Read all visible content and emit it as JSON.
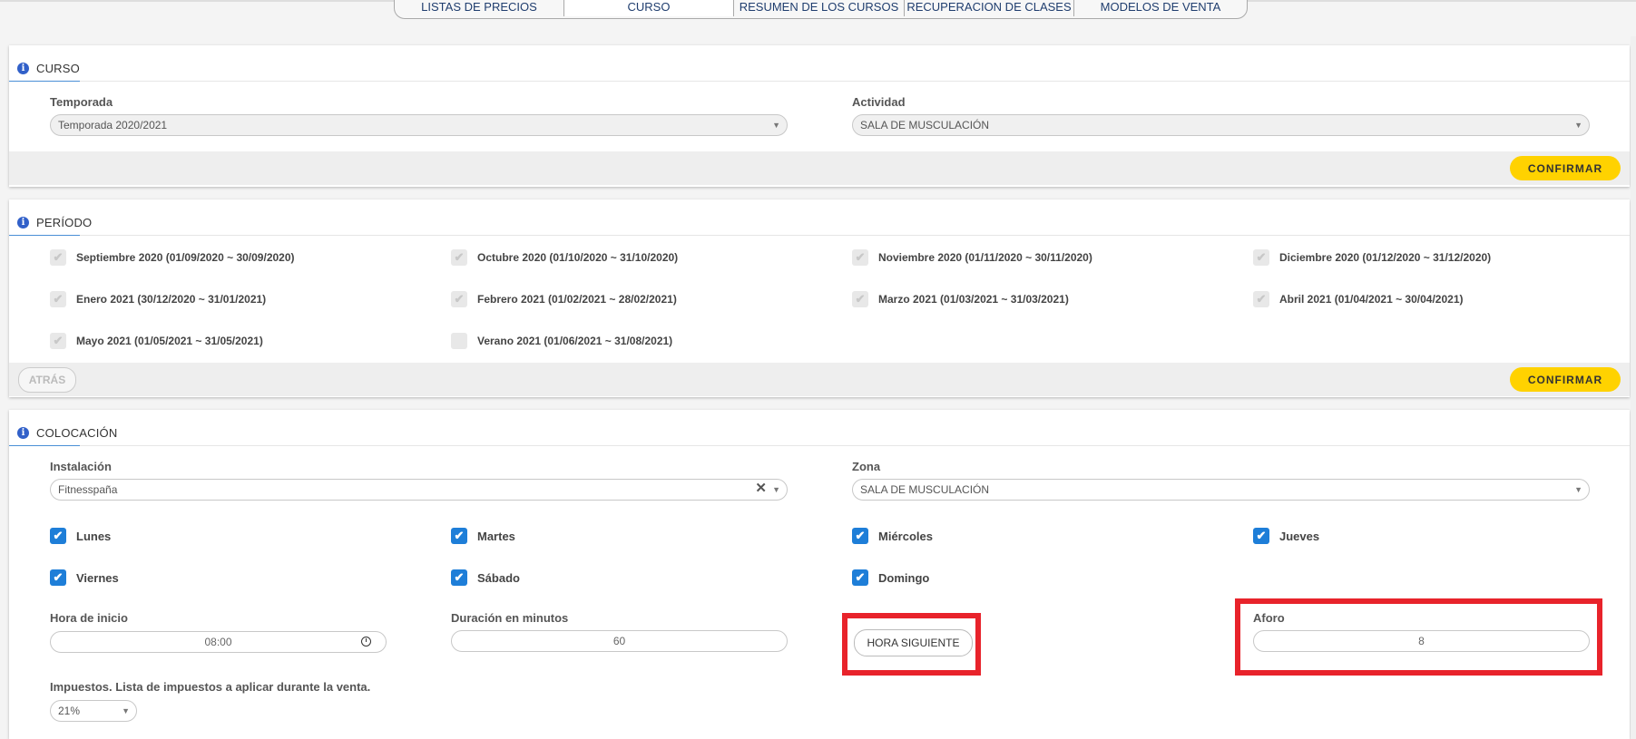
{
  "tabs": [
    "LISTAS DE PRECIOS",
    "CURSO",
    "RESUMEN DE LOS CURSOS",
    "RECUPERACION DE CLASES",
    "MODELOS DE VENTA"
  ],
  "curso": {
    "title": "CURSO",
    "temporada_label": "Temporada",
    "temporada_value": "Temporada 2020/2021",
    "actividad_label": "Actividad",
    "actividad_value": "SALA DE MUSCULACIÓN",
    "confirm": "CONFIRMAR"
  },
  "periodo": {
    "title": "PERÍODO",
    "items": [
      "Septiembre 2020 (01/09/2020 ~ 30/09/2020)",
      "Octubre 2020 (01/10/2020 ~ 31/10/2020)",
      "Noviembre 2020 (01/11/2020 ~ 30/11/2020)",
      "Diciembre 2020 (01/12/2020 ~ 31/12/2020)",
      "Enero 2021 (30/12/2020 ~ 31/01/2021)",
      "Febrero 2021 (01/02/2021 ~ 28/02/2021)",
      "Marzo 2021 (01/03/2021 ~ 31/03/2021)",
      "Abril 2021 (01/04/2021 ~ 30/04/2021)",
      "Mayo 2021 (01/05/2021 ~ 31/05/2021)",
      "Verano 2021 (01/06/2021 ~ 31/08/2021)"
    ],
    "back": "ATRÁS",
    "confirm": "CONFIRMAR"
  },
  "colocacion": {
    "title": "COLOCACIÓN",
    "instalacion_label": "Instalación",
    "instalacion_value": "Fitnesspaña",
    "zona_label": "Zona",
    "zona_value": "SALA DE MUSCULACIÓN",
    "days": [
      "Lunes",
      "Martes",
      "Miércoles",
      "Jueves",
      "Viernes",
      "Sábado",
      "Domingo"
    ],
    "hora_label": "Hora de inicio",
    "hora_value": "08:00",
    "duracion_label": "Duración en minutos",
    "duracion_value": "60",
    "hora_siguiente": "HORA SIGUIENTE",
    "aforo_label": "Aforo",
    "aforo_value": "8",
    "impuestos_label": "Impuestos. Lista de impuestos a aplicar durante la venta.",
    "impuestos_value": "21%"
  },
  "colors": {
    "accent": "#1e7ed8",
    "confirm": "#ffd200",
    "highlight": "#e8232b",
    "info": "#3160c9"
  }
}
